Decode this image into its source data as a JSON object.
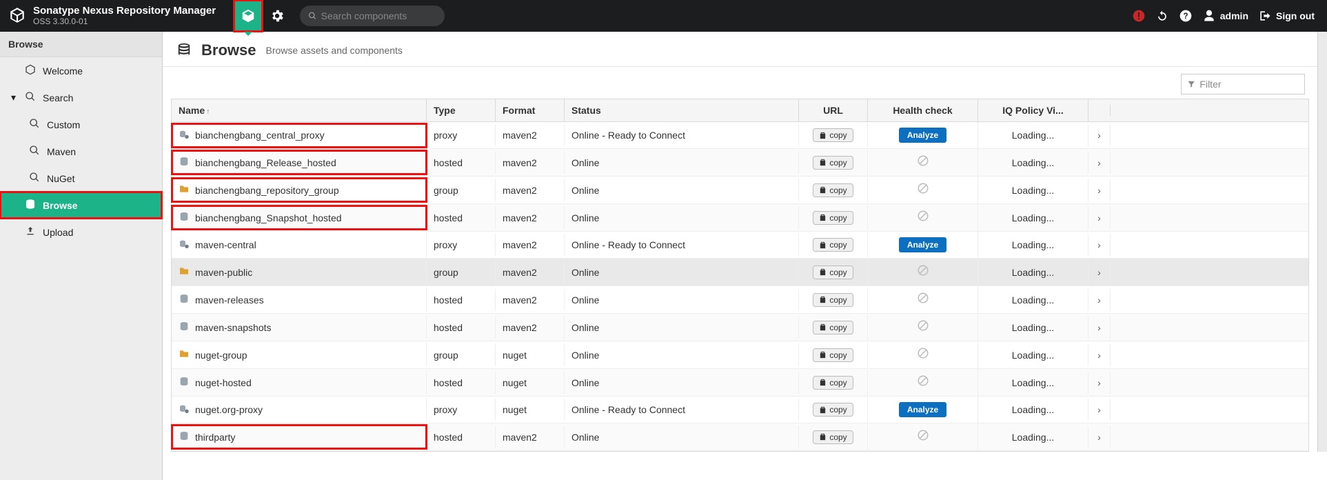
{
  "header": {
    "product_title": "Sonatype Nexus Repository Manager",
    "product_version": "OSS 3.30.0-01",
    "search_placeholder": "Search components",
    "user_label": "admin",
    "signout_label": "Sign out"
  },
  "sidebar": {
    "section_label": "Browse",
    "items": [
      {
        "label": "Welcome",
        "icon": "hexagon"
      },
      {
        "label": "Search",
        "icon": "search",
        "expandable": true,
        "expanded": true
      },
      {
        "label": "Custom",
        "icon": "search",
        "child": true
      },
      {
        "label": "Maven",
        "icon": "search",
        "child": true
      },
      {
        "label": "NuGet",
        "icon": "search",
        "child": true
      },
      {
        "label": "Browse",
        "icon": "database",
        "active": true,
        "highlight_box": true
      },
      {
        "label": "Upload",
        "icon": "upload"
      }
    ]
  },
  "page": {
    "title": "Browse",
    "subtitle": "Browse assets and components",
    "filter_placeholder": "Filter"
  },
  "table": {
    "columns": [
      {
        "label": "Name",
        "sorted": "asc"
      },
      {
        "label": "Type"
      },
      {
        "label": "Format"
      },
      {
        "label": "Status"
      },
      {
        "label": "URL"
      },
      {
        "label": "Health check"
      },
      {
        "label": "IQ Policy Vi..."
      }
    ],
    "copy_label": "copy",
    "analyze_label": "Analyze",
    "loading_label": "Loading...",
    "rows": [
      {
        "name": "bianchengbang_central_proxy",
        "type": "proxy",
        "format": "maven2",
        "status": "Online - Ready to Connect",
        "health": "analyze",
        "icon": "proxy",
        "highlight_box": true
      },
      {
        "name": "bianchengbang_Release_hosted",
        "type": "hosted",
        "format": "maven2",
        "status": "Online",
        "health": "na",
        "icon": "hosted",
        "highlight_box": true
      },
      {
        "name": "bianchengbang_repository_group",
        "type": "group",
        "format": "maven2",
        "status": "Online",
        "health": "na",
        "icon": "group",
        "highlight_box": true
      },
      {
        "name": "bianchengbang_Snapshot_hosted",
        "type": "hosted",
        "format": "maven2",
        "status": "Online",
        "health": "na",
        "icon": "hosted",
        "highlight_box": true
      },
      {
        "name": "maven-central",
        "type": "proxy",
        "format": "maven2",
        "status": "Online - Ready to Connect",
        "health": "analyze",
        "icon": "proxy"
      },
      {
        "name": "maven-public",
        "type": "group",
        "format": "maven2",
        "status": "Online",
        "health": "na",
        "icon": "group",
        "hover": true
      },
      {
        "name": "maven-releases",
        "type": "hosted",
        "format": "maven2",
        "status": "Online",
        "health": "na",
        "icon": "hosted"
      },
      {
        "name": "maven-snapshots",
        "type": "hosted",
        "format": "maven2",
        "status": "Online",
        "health": "na",
        "icon": "hosted"
      },
      {
        "name": "nuget-group",
        "type": "group",
        "format": "nuget",
        "status": "Online",
        "health": "na",
        "icon": "group"
      },
      {
        "name": "nuget-hosted",
        "type": "hosted",
        "format": "nuget",
        "status": "Online",
        "health": "na",
        "icon": "hosted"
      },
      {
        "name": "nuget.org-proxy",
        "type": "proxy",
        "format": "nuget",
        "status": "Online - Ready to Connect",
        "health": "analyze",
        "icon": "proxy"
      },
      {
        "name": "thirdparty",
        "type": "hosted",
        "format": "maven2",
        "status": "Online",
        "health": "na",
        "icon": "hosted",
        "highlight_box": true
      }
    ]
  }
}
